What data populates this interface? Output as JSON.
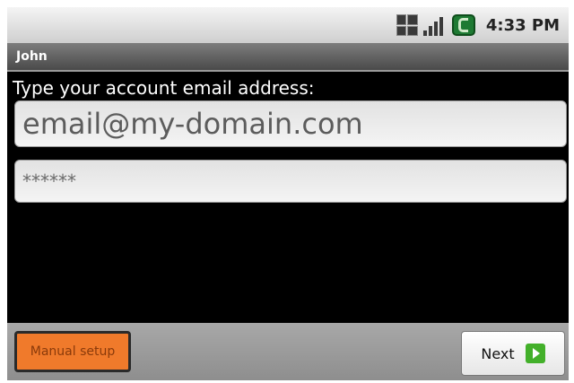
{
  "status_bar": {
    "time": "4:33 PM",
    "icons": [
      "sim-icon",
      "signal-icon",
      "battery-icon"
    ]
  },
  "title_bar": {
    "title": "John"
  },
  "form": {
    "prompt": "Type your account email address:",
    "email_value": "email@my-domain.com",
    "password_value": "******"
  },
  "bottom_bar": {
    "manual_setup_label": "Manual setup",
    "next_label": "Next"
  },
  "colors": {
    "accent_orange": "#f07a2b",
    "next_green": "#43b02a"
  }
}
